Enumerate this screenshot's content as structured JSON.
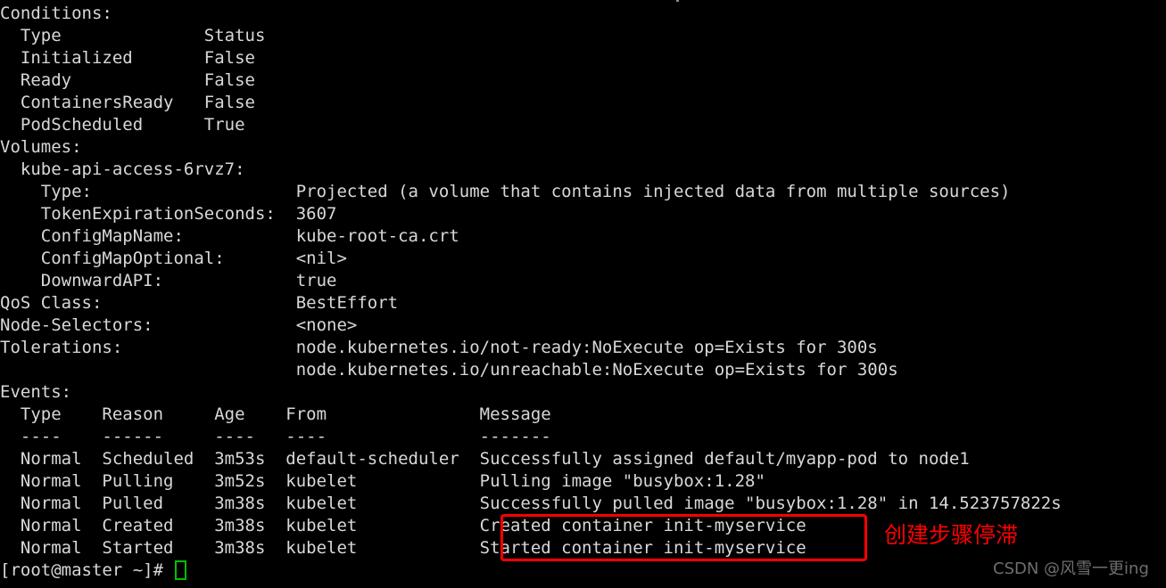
{
  "terminal": {
    "colors": {
      "background": "#000000",
      "foreground": "#d8d8d8",
      "cursor": "#00c000",
      "annotation": "#ff0000",
      "watermark": "#6e6e6e"
    },
    "conditions": {
      "section_label": "Conditions:",
      "header": "  Type              Status",
      "rows": [
        "  Initialized       False",
        "  Ready             False",
        "  ContainersReady   False",
        "  PodScheduled      True"
      ]
    },
    "volumes": {
      "section_label": "Volumes:",
      "volume_name": "  kube-api-access-6rvz7:",
      "rows": [
        "    Type:                    Projected (a volume that contains injected data from multiple sources)",
        "    TokenExpirationSeconds:  3607",
        "    ConfigMapName:           kube-root-ca.crt",
        "    ConfigMapOptional:       <nil>",
        "    DownwardAPI:             true"
      ]
    },
    "pod_meta": {
      "rows": [
        "QoS Class:                   BestEffort",
        "Node-Selectors:              <none>",
        "Tolerations:                 node.kubernetes.io/not-ready:NoExecute op=Exists for 300s",
        "                             node.kubernetes.io/unreachable:NoExecute op=Exists for 300s"
      ]
    },
    "events": {
      "section_label": "Events:",
      "columns": [
        "Type",
        "Reason",
        "Age",
        "From",
        "Message"
      ],
      "header_line": "  Type    Reason     Age    From               Message",
      "separator_line": "  ----    ------     ----   ----               -------",
      "rows": [
        {
          "type": "Normal",
          "reason": "Scheduled",
          "age": "3m53s",
          "from": "default-scheduler",
          "message": "Successfully assigned default/myapp-pod to node1",
          "line": "  Normal  Scheduled  3m53s  default-scheduler  Successfully assigned default/myapp-pod to node1"
        },
        {
          "type": "Normal",
          "reason": "Pulling",
          "age": "3m52s",
          "from": "kubelet",
          "message": "Pulling image \"busybox:1.28\"",
          "line": "  Normal  Pulling    3m52s  kubelet            Pulling image \"busybox:1.28\""
        },
        {
          "type": "Normal",
          "reason": "Pulled",
          "age": "3m38s",
          "from": "kubelet",
          "message": "Successfully pulled image \"busybox:1.28\" in 14.523757822s",
          "line": "  Normal  Pulled     3m38s  kubelet            Successfully pulled image \"busybox:1.28\" in 14.523757822s"
        },
        {
          "type": "Normal",
          "reason": "Created",
          "age": "3m38s",
          "from": "kubelet",
          "message": "Created container init-myservice",
          "line": "  Normal  Created    3m38s  kubelet            Created container init-myservice"
        },
        {
          "type": "Normal",
          "reason": "Started",
          "age": "3m38s",
          "from": "kubelet",
          "message": "Started container init-myservice",
          "line": "  Normal  Started    3m38s  kubelet            Started container init-myservice"
        }
      ]
    },
    "prompt": {
      "text": "[root@master ~]# ",
      "cursor_glyph": "block-outline-cursor"
    },
    "annotation": {
      "text": "创建步骤停滞",
      "color": "#ff0000",
      "highlight_shape": "red-rectangle"
    },
    "watermark": {
      "text": "CSDN @风雪一更ing"
    }
  }
}
